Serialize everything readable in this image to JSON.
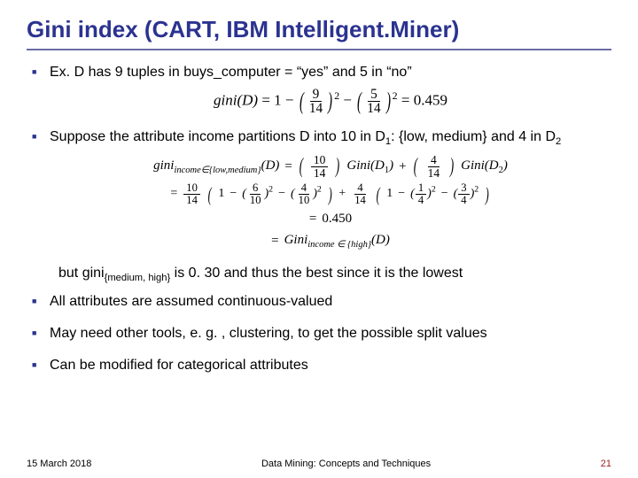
{
  "title": "Gini index (CART, IBM Intelligent.Miner)",
  "bullets": {
    "b1": "Ex.  D has 9 tuples in buys_computer = “yes” and 5 in “no”",
    "b2_a": "Suppose the attribute income partitions D into 10 in D",
    "b2_b": ": {low, medium} and 4 in D",
    "b3_a": "but gini",
    "b3_sub": "{medium, high}",
    "b3_b": " is 0. 30 and thus the best since it is the lowest",
    "b4": "All attributes are assumed continuous-valued",
    "b5": "May need other tools, e. g. , clustering, to get the possible split values",
    "b6": "Can be modified for categorical attributes"
  },
  "formulas": {
    "f1": {
      "lhs": "gini(D)",
      "eq": "=",
      "one": "1",
      "minus": "−",
      "n1": "9",
      "d1": "14",
      "n2": "5",
      "d2": "14",
      "sq": "2",
      "result": "0.459"
    },
    "f2": {
      "lhs_a": "gini",
      "lhs_sub": "income∈{low,medium}",
      "lhs_b": "(D)",
      "eq": "=",
      "n1": "10",
      "d1": "14",
      "g1": "Gini(D",
      "g1s": "1",
      "g1e": ")",
      "plus": "+",
      "n2": "4",
      "d2": "14",
      "g2": "Gini(D",
      "g2s": "2",
      "g2e": ")"
    },
    "f3": {
      "eq": "=",
      "n0": "10",
      "d0": "14",
      "open": "(",
      "one": "1",
      "minus": "−",
      "n1": "6",
      "d1": "10",
      "sq": "2",
      "n2": "4",
      "d2": "10",
      "close": ")",
      "plus": "+",
      "n3": "4",
      "d3": "14",
      "n4": "1",
      "d4": "4",
      "n5": "3",
      "d5": "4"
    },
    "f4": {
      "eq": "=",
      "val": "0.450"
    },
    "f5": {
      "eq": "=",
      "lhs_a": "Gini",
      "lhs_sub": "income ∈ {high}",
      "lhs_b": "(D)"
    }
  },
  "subs": {
    "one": "1",
    "two": "2"
  },
  "footer": {
    "date": "15 March 2018",
    "center": "Data Mining: Concepts and Techniques",
    "page": "21"
  }
}
